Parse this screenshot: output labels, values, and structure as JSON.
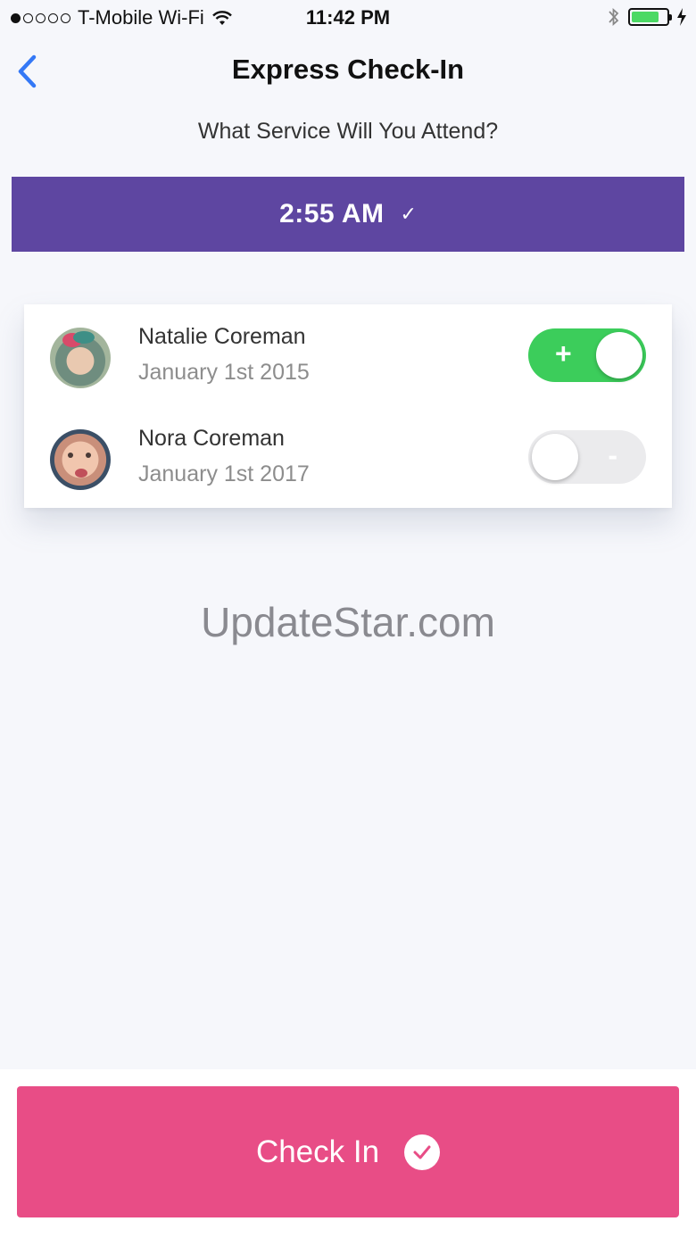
{
  "status_bar": {
    "carrier": "T-Mobile Wi-Fi",
    "time": "11:42 PM",
    "signal_bars_filled": 1,
    "signal_bars_total": 5
  },
  "nav": {
    "title": "Express Check-In",
    "back_icon": "chevron-left-icon"
  },
  "prompt": "What Service Will You Attend?",
  "service": {
    "time": "2:55 AM",
    "check": "✓",
    "color": "#5e46a1"
  },
  "people": [
    {
      "name": "Natalie Coreman",
      "date": "January 1st 2015",
      "checked_in": true,
      "toggle_symbol": "+"
    },
    {
      "name": "Nora Coreman",
      "date": "January 1st 2017",
      "checked_in": false,
      "toggle_symbol": "-"
    }
  ],
  "watermark": "UpdateStar.com",
  "checkin_button": {
    "label": "Check In",
    "color": "#e84d86"
  },
  "colors": {
    "toggle_on": "#3ccd5b",
    "back_arrow": "#3478f6"
  }
}
